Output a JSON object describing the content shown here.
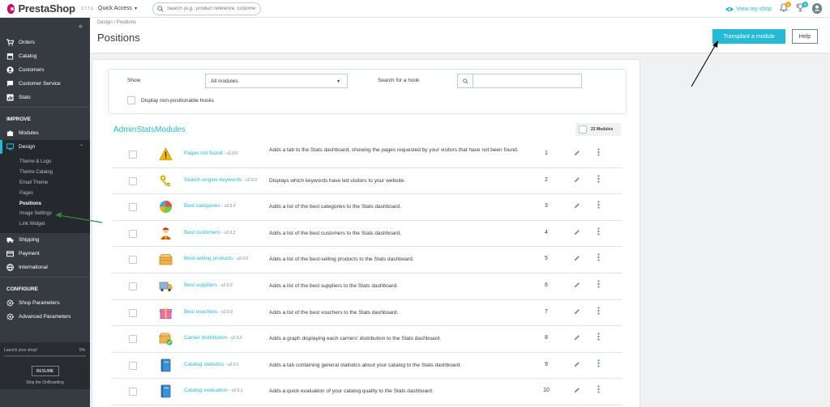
{
  "topbar": {
    "logo_text": "PrestaShop",
    "version": "1.7.7.1",
    "quick_access": "Quick Access",
    "search_placeholder": "Search (e.g.: product reference, custome",
    "view_shop": "View my shop",
    "orders_badge": "1",
    "customers_badge": "6",
    "brand_color": "#df0067",
    "accent_color": "#25b9d7"
  },
  "sidebar": {
    "collapse_icon": "double-chevron-left-icon",
    "items_top": [
      {
        "label": "Orders",
        "icon": "cart-icon"
      },
      {
        "label": "Catalog",
        "icon": "store-icon"
      },
      {
        "label": "Customers",
        "icon": "account-icon"
      },
      {
        "label": "Customer Service",
        "icon": "chat-icon"
      },
      {
        "label": "Stats",
        "icon": "stats-icon"
      }
    ],
    "improve_title": "IMPROVE",
    "modules_label": "Modules",
    "design_label": "Design",
    "design_sub": [
      "Theme & Logo",
      "Theme Catalog",
      "Email Theme",
      "Pages",
      "Positions",
      "Image Settings",
      "Link Widget"
    ],
    "items_after": [
      {
        "label": "Shipping",
        "icon": "truck-icon"
      },
      {
        "label": "Payment",
        "icon": "payment-icon"
      },
      {
        "label": "International",
        "icon": "globe-icon"
      }
    ],
    "configure_title": "CONFIGURE",
    "configure_items": [
      {
        "label": "Shop Parameters",
        "icon": "settings-icon"
      },
      {
        "label": "Advanced Parameters",
        "icon": "gear-icon"
      }
    ],
    "onboarding": {
      "launch_text": "Launch your shop!",
      "progress": "0%",
      "resume": "RESUME",
      "stop": "Stop the OnBoarding"
    }
  },
  "header": {
    "breadcrumb_parent": "Design",
    "breadcrumb_sep": "/",
    "breadcrumb_current": "Positions",
    "title": "Positions",
    "transplant_label": "Transplant a module",
    "help_label": "Help"
  },
  "filter": {
    "show_label": "Show",
    "show_value": "All modules",
    "hook_label": "Search for a hook",
    "hook_value": "",
    "nonpos_label": "Display non-positionable hooks"
  },
  "group": {
    "title": "AdminStatsModules",
    "count": "22 Modules"
  },
  "modules": [
    {
      "name": "Pages not found",
      "version": "- v2.0.0",
      "desc": "Adds a tab to the Stats dashboard, showing the pages requested by your visitors that have not been found.",
      "pos": "1",
      "icon": "warning-icon"
    },
    {
      "name": "Search engine keywords",
      "version": "- v2.0.0",
      "desc": "Displays which keywords have led visitors to your website.",
      "pos": "2",
      "icon": "keys-icon"
    },
    {
      "name": "Best categories",
      "version": "- v2.0.0",
      "desc": "Adds a list of the best categories to the Stats dashboard.",
      "pos": "3",
      "icon": "pie-chart-icon"
    },
    {
      "name": "Best customers",
      "version": "- v2.0.2",
      "desc": "Adds a list of the best customers to the Stats dashboard.",
      "pos": "4",
      "icon": "customer-icon"
    },
    {
      "name": "Best-selling products",
      "version": "- v2.0.0",
      "desc": "Adds a list of the best-selling products to the Stats dashboard.",
      "pos": "5",
      "icon": "box-icon"
    },
    {
      "name": "Best suppliers",
      "version": "- v2.0.0",
      "desc": "Adds a list of the best suppliers to the Stats dashboard.",
      "pos": "6",
      "icon": "delivery-truck-icon"
    },
    {
      "name": "Best vouchers",
      "version": "- v2.0.0",
      "desc": "Adds a list of the best vouchers to the Stats dashboard.",
      "pos": "7",
      "icon": "gift-icon"
    },
    {
      "name": "Carrier distribution",
      "version": "- v2.0.0",
      "desc": "Adds a graph displaying each carriers' distribution to the Stats dashboard.",
      "pos": "8",
      "icon": "carrier-box-icon"
    },
    {
      "name": "Catalog statistics",
      "version": "- v2.0.1",
      "desc": "Adds a tab containing general statistics about your catalog to the Stats dashboard.",
      "pos": "9",
      "icon": "catalog-book-icon"
    },
    {
      "name": "Catalog evaluation",
      "version": "- v2.0.1",
      "desc": "Adds a quick evaluation of your catalog quality to the Stats dashboard.",
      "pos": "10",
      "icon": "catalog-book-icon"
    }
  ]
}
